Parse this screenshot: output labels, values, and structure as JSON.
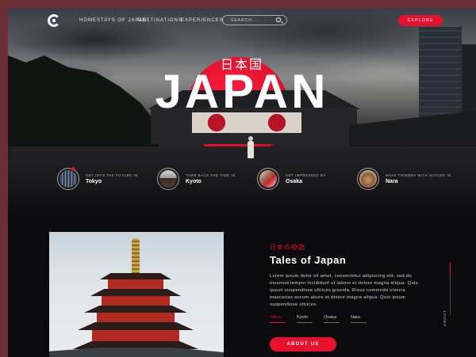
{
  "nav": {
    "links": [
      "HOMESTAYS OF JAPAN",
      "DESTINATIONS",
      "EXPERIENCES"
    ],
    "search_placeholder": "SEARCH...",
    "explore_label": "EXPLORE"
  },
  "hero": {
    "kanji": "日本国",
    "title": "JAPAN"
  },
  "cities": [
    {
      "tag": "GET INTO THE FUTURE IN",
      "name": "Tokyo"
    },
    {
      "tag": "TURN BACK THE TIME IN",
      "name": "Kyoto"
    },
    {
      "tag": "GET IMPRESSED BY",
      "name": "Osaka"
    },
    {
      "tag": "MAKE FRIENDS WITH NATURE IN",
      "name": "Nara"
    }
  ],
  "tales": {
    "subtitle_jp": "日本の物語",
    "title": "Tales of Japan",
    "body": "Lorem ipsum dolor sit amet, consectetur adipiscing elit, sed do eiusmod tempor incididunt ut labore et dolore magna aliqua. Quis ipsum suspendisse ultrices gravida. Risus commodo viverra maecenas accum abore et dolore magna aliqua. Quis ipsum suspendisse ultrices.",
    "tabs": [
      "Tokyo",
      "Kyoto",
      "Osaka",
      "Nara"
    ],
    "active_tab": "Tokyo",
    "button_label": "ABOUT US"
  },
  "side_label": "ABOUT",
  "colors": {
    "accent": "#e8102c",
    "background": "#0b0b0e",
    "outer": "#6b2f38"
  }
}
